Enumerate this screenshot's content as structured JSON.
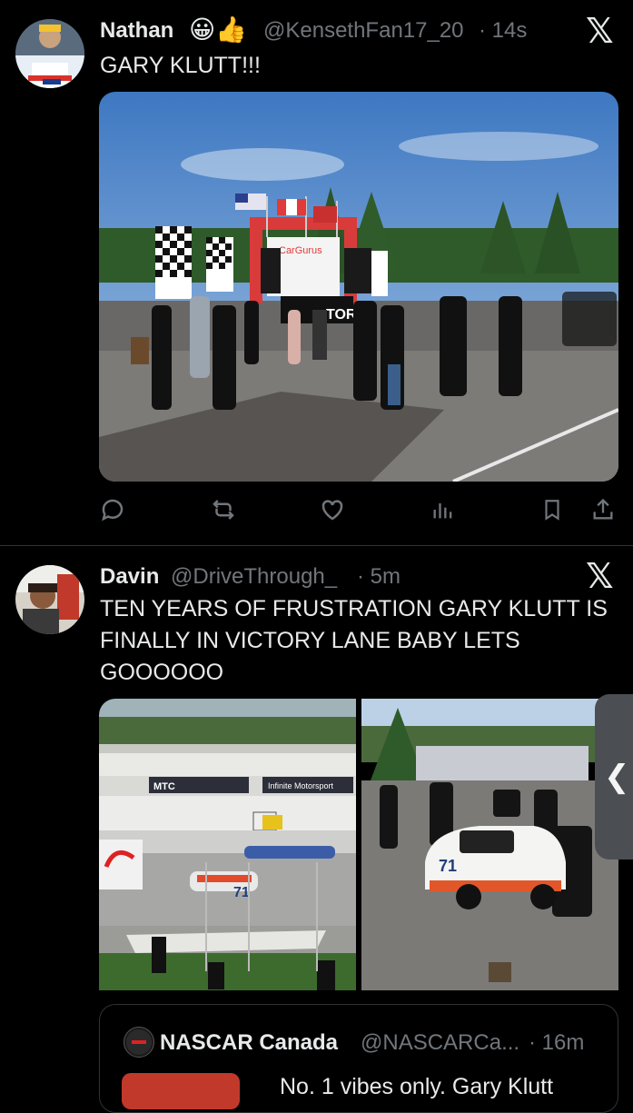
{
  "tweet1": {
    "name": "Nathan",
    "emojis": "😀👍",
    "handle": "@KensethFan17_20",
    "time": "· 14s",
    "text": "GARY KLUTT!!!",
    "image_labels": {
      "banner": "CarGurus",
      "stage": "TORY"
    }
  },
  "tweet2": {
    "name": "Davin",
    "handle": "@DriveThrough_",
    "time": "· 5m",
    "text_line1": "TEN YEARS OF FRUSTRATION GARY KLUTT IS",
    "text_line2": "FINALLY IN VICTORY LANE BABY LETS",
    "text_line3": "GOOOOOO",
    "image_labels": {
      "mtc": "MTC",
      "infinite": "Infinite Motorsport",
      "car_number": "71"
    },
    "quote": {
      "name": "NASCAR Canada",
      "handle": "@NASCARCa...",
      "time": "· 16m",
      "text": "No. 1 vibes only. Gary Klutt"
    }
  },
  "ui": {
    "x_icon": "𝕏",
    "side_handle": "❮"
  },
  "colors": {
    "bg": "#000000",
    "text": "#e7e9ea",
    "muted": "#71767b",
    "divider": "#2f3336"
  }
}
